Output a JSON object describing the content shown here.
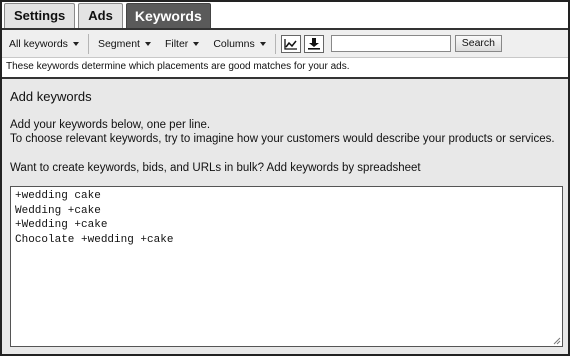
{
  "tabs": [
    {
      "label": "Settings",
      "active": false
    },
    {
      "label": "Ads",
      "active": false
    },
    {
      "label": "Keywords",
      "active": true
    }
  ],
  "toolbar": {
    "all_keywords": "All keywords",
    "segment": "Segment",
    "filter": "Filter",
    "columns": "Columns",
    "chart_icon": "line-chart-icon",
    "download_icon": "download-icon",
    "search_value": "",
    "search_button": "Search"
  },
  "info_text": "These keywords determine which placements are good matches for your ads.",
  "panel": {
    "title": "Add keywords",
    "line1": "Add your keywords below, one per line.",
    "line2": "To choose relevant keywords, try to imagine how your customers would describe your products or services.",
    "line3": "Want to create keywords, bids, and URLs in bulk? Add keywords by spreadsheet",
    "keywords": [
      "+wedding cake",
      "Wedding +cake",
      "+Wedding +cake",
      "Chocolate +wedding +cake"
    ]
  }
}
